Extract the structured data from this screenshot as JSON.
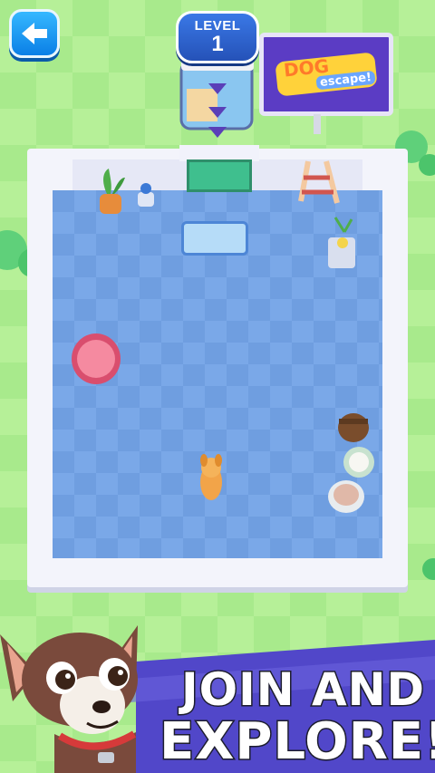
{
  "hud": {
    "level_label": "LEVEL",
    "level_number": "1"
  },
  "billboard": {
    "logo_word_1": "DOG",
    "logo_word_2": "escape!"
  },
  "banner": {
    "line1": "JOIN AND",
    "line2": "EXPLORE!"
  },
  "colors": {
    "grass": "#a8ea8c",
    "floor": "#6f9ee0",
    "button_blue": "#1a96f0",
    "billboard_purple": "#5b3cc4",
    "banner_purple": "#5147c9"
  }
}
